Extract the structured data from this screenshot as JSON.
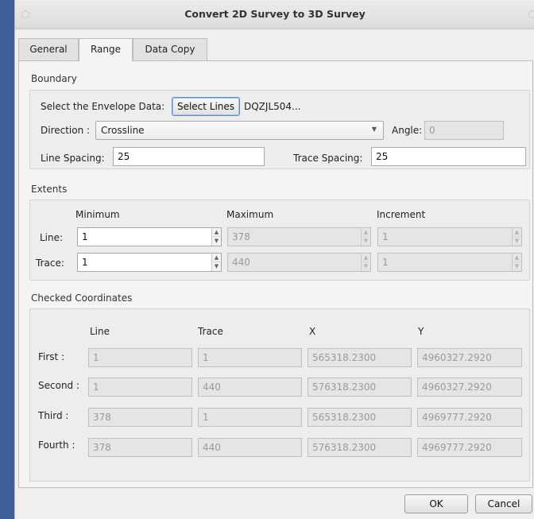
{
  "window": {
    "title": "Convert 2D Survey to 3D Survey"
  },
  "tabs": [
    "General",
    "Range",
    "Data Copy"
  ],
  "boundary": {
    "title": "Boundary",
    "envelope_label": "Select the Envelope Data:",
    "select_lines_button": "Select Lines",
    "selected_lines": "DQZJL504...",
    "direction_label": "Direction :",
    "direction_value": "Crossline",
    "angle_label": "Angle:",
    "angle_value": "0",
    "line_spacing_label": "Line Spacing:",
    "line_spacing_value": "25",
    "trace_spacing_label": "Trace Spacing:",
    "trace_spacing_value": "25"
  },
  "extents": {
    "title": "Extents",
    "headers": [
      "Minimum",
      "Maximum",
      "Increment"
    ],
    "rows": [
      {
        "label": "Line:",
        "min": "1",
        "max": "378",
        "inc": "1"
      },
      {
        "label": "Trace:",
        "min": "1",
        "max": "440",
        "inc": "1"
      }
    ]
  },
  "checked": {
    "title": "Checked Coordinates",
    "headers": [
      "Line",
      "Trace",
      "X",
      "Y"
    ],
    "rows": [
      {
        "label": "First :",
        "line": "1",
        "trace": "1",
        "x": "565318.2300",
        "y": "4960327.2920"
      },
      {
        "label": "Second :",
        "line": "1",
        "trace": "440",
        "x": "576318.2300",
        "y": "4960327.2920"
      },
      {
        "label": "Third :",
        "line": "378",
        "trace": "1",
        "x": "565318.2300",
        "y": "4969777.2920"
      },
      {
        "label": "Fourth :",
        "line": "378",
        "trace": "440",
        "x": "576318.2300",
        "y": "4969777.2920"
      }
    ]
  },
  "footer": {
    "ok": "OK",
    "cancel": "Cancel"
  }
}
